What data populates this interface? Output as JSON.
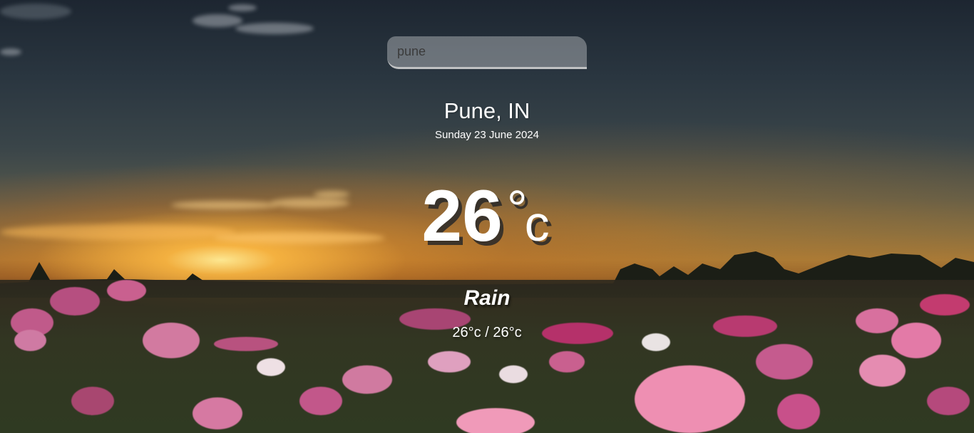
{
  "search": {
    "value": "pune"
  },
  "location": {
    "name": "Pune, IN",
    "date": "Sunday 23 June 2024"
  },
  "weather": {
    "temperature": "26",
    "degree_symbol": "°",
    "unit": "c",
    "condition": "Rain",
    "hi_low": "26°c / 26°c"
  },
  "icons": [
    "background-landscape-image"
  ]
}
